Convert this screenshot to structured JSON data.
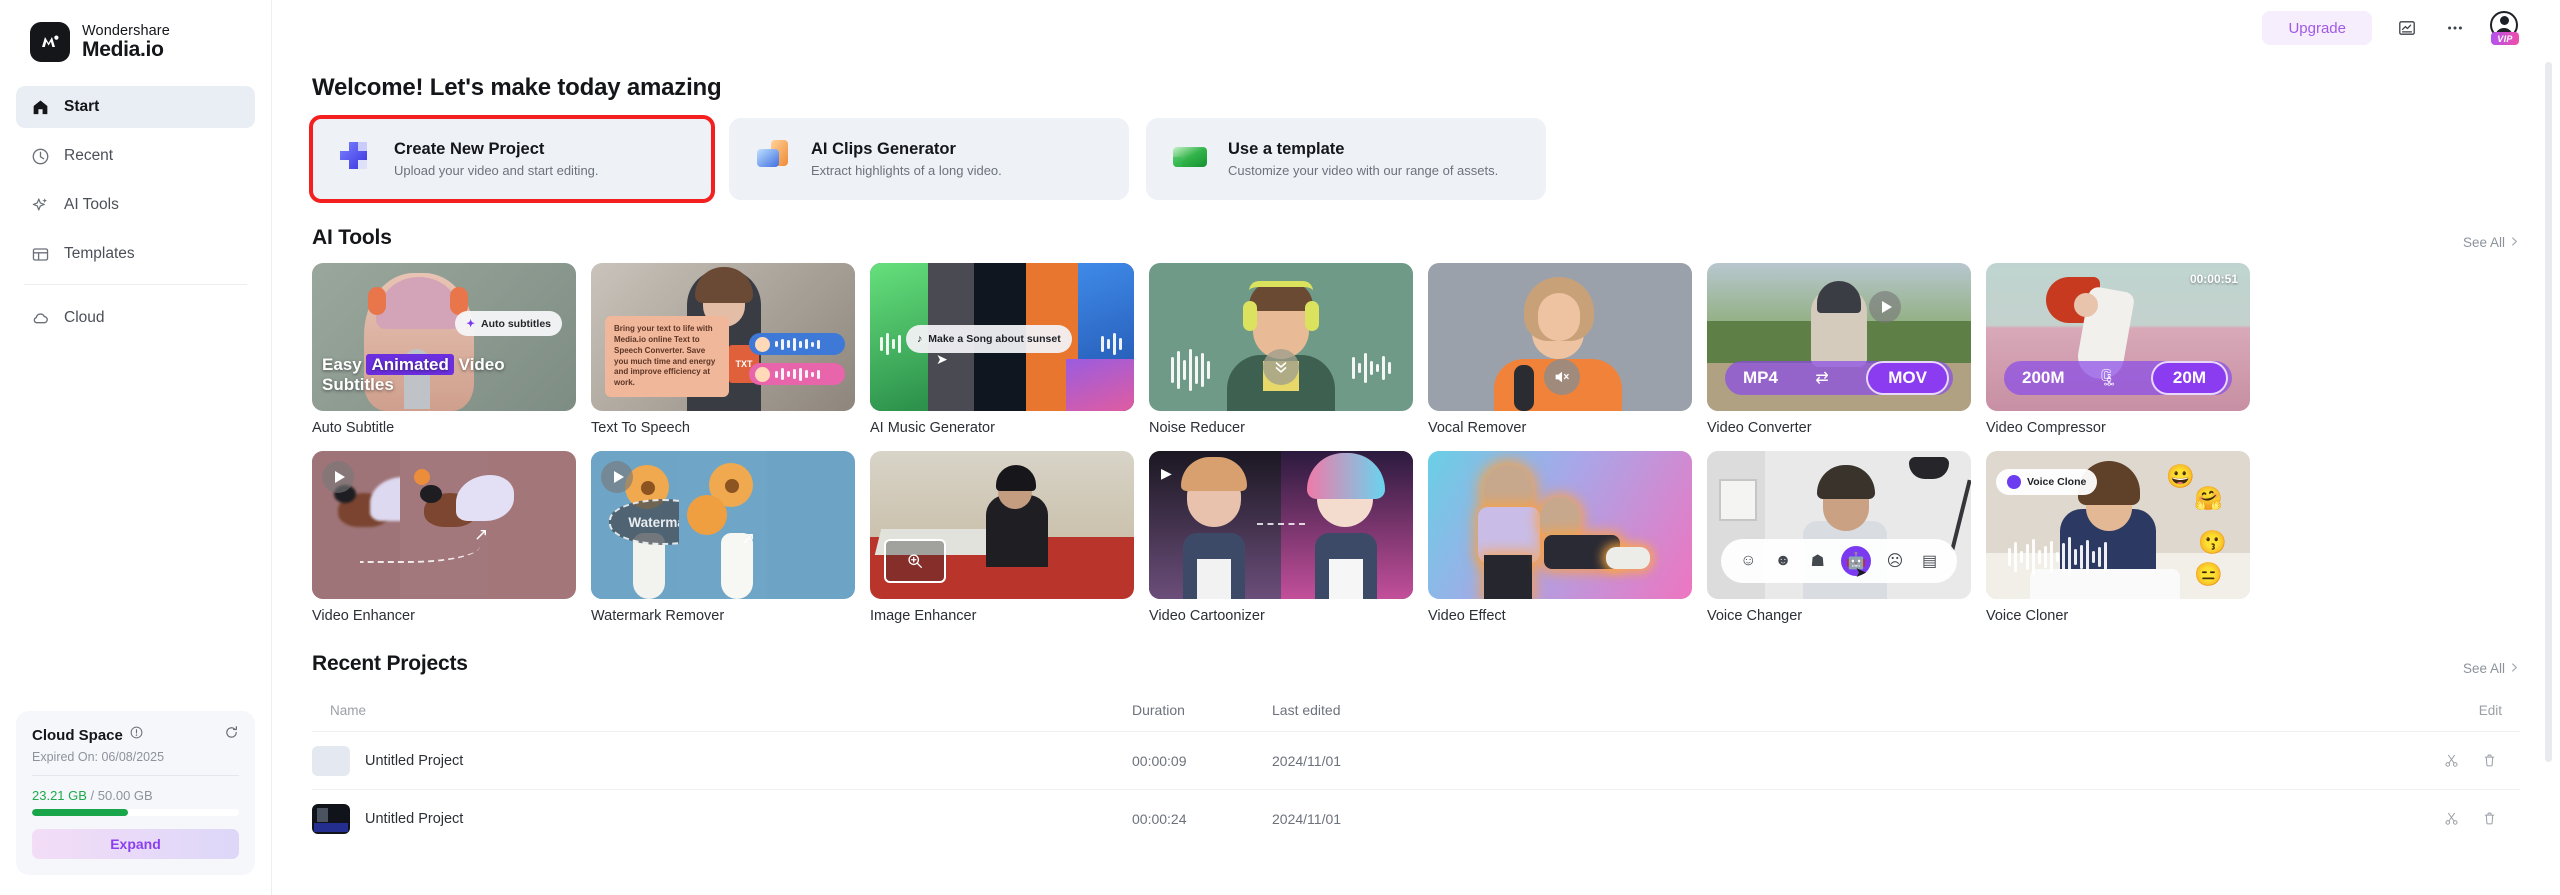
{
  "brand": {
    "top": "Wondershare",
    "bottom": "Media.io",
    "mark": "M"
  },
  "sidebar": {
    "items": [
      {
        "label": "Start",
        "icon": "home-icon",
        "active": true
      },
      {
        "label": "Recent",
        "icon": "clock-icon",
        "active": false
      },
      {
        "label": "AI Tools",
        "icon": "sparkle-icon",
        "active": false
      },
      {
        "label": "Templates",
        "icon": "layout-icon",
        "active": false
      },
      {
        "label": "Cloud",
        "icon": "cloud-icon",
        "active": false
      }
    ],
    "cloud": {
      "title": "Cloud Space",
      "info_icon": "info-icon",
      "refresh_icon": "refresh-icon",
      "expired_label": "Expired On: 06/08/2025",
      "used": "23.21 GB",
      "separator": " / ",
      "total": "50.00 GB",
      "percent": 46.4,
      "expand_label": "Expand",
      "used_color": "#19a64a"
    }
  },
  "topbar": {
    "upgrade_label": "Upgrade",
    "feedback_icon": "feedback-icon",
    "more_icon": "more-horizontal-icon",
    "avatar_icon": "avatar-icon",
    "vip_label": "VIP"
  },
  "main": {
    "welcome_title": "Welcome! Let's make today amazing",
    "feature_cards": [
      {
        "title": "Create New Project",
        "subtitle": "Upload your video and start editing.",
        "icon": "plus-tile-icon",
        "highlighted": true
      },
      {
        "title": "AI Clips Generator",
        "subtitle": "Extract highlights of a long video.",
        "icon": "clips-tile-icon",
        "highlighted": false
      },
      {
        "title": "Use a template",
        "subtitle": "Customize your video with our range of assets.",
        "icon": "template-tile-icon",
        "highlighted": false
      }
    ],
    "ai_tools": {
      "section_title": "AI Tools",
      "see_all_label": "See All",
      "see_all_chevron": "chevron-right-icon",
      "items": [
        {
          "label": "Auto Subtitle",
          "art": "auto-subtitle",
          "overlay_pill": "Auto subtitles",
          "caption_pre": "Easy ",
          "caption_hl": "Animated",
          "caption_post": " Video Subtitles"
        },
        {
          "label": "Text To Speech",
          "art": "text-to-speech",
          "note": "Bring your text to life with Media.io online Text to Speech Converter. Save you much time and energy and improve efficiency at work.",
          "file_label": "TXT"
        },
        {
          "label": "AI Music Generator",
          "art": "ai-music",
          "overlay_pill": "Make a Song about sunset"
        },
        {
          "label": "Noise Reducer",
          "art": "noise-reducer"
        },
        {
          "label": "Vocal Remover",
          "art": "vocal-remover"
        },
        {
          "label": "Video Converter",
          "art": "video-converter",
          "from": "MP4",
          "to": "MOV"
        },
        {
          "label": "Video Compressor",
          "art": "video-compressor",
          "from": "200M",
          "to": "20M",
          "time": "00:00:51"
        },
        {
          "label": "Video Enhancer",
          "art": "video-enhancer"
        },
        {
          "label": "Watermark Remover",
          "art": "watermark-remover",
          "watermark_label": "Watermark"
        },
        {
          "label": "Image Enhancer",
          "art": "image-enhancer"
        },
        {
          "label": "Video Cartoonizer",
          "art": "video-cartoonizer"
        },
        {
          "label": "Video Effect",
          "art": "video-effect"
        },
        {
          "label": "Voice Changer",
          "art": "voice-changer"
        },
        {
          "label": "Voice Cloner",
          "art": "voice-cloner",
          "overlay_pill": "Voice Clone"
        }
      ]
    },
    "recent_projects": {
      "section_title": "Recent Projects",
      "see_all_label": "See All",
      "columns": {
        "name": "Name",
        "duration": "Duration",
        "last_edited": "Last edited",
        "edit": "Edit"
      },
      "rows": [
        {
          "name": "Untitled Project",
          "duration": "00:00:09",
          "last_edited": "2024/11/01",
          "thumb": "blank"
        },
        {
          "name": "Untitled Project",
          "duration": "00:00:24",
          "last_edited": "2024/11/01",
          "thumb": "dark"
        }
      ],
      "row_actions": {
        "cut_icon": "scissors-icon",
        "delete_icon": "trash-icon"
      }
    }
  }
}
